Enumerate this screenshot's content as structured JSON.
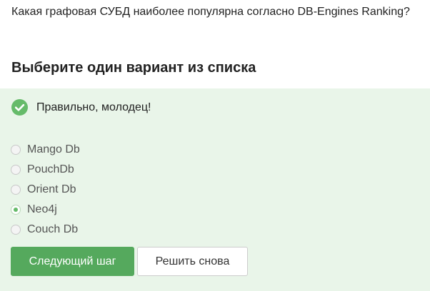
{
  "question": {
    "text": "Какая графовая СУБД наиболее популярна согласно DB-Engines Ranking?"
  },
  "section_title": "Выберите один вариант из списка",
  "feedback": {
    "icon": "check-circle-icon",
    "text": "Правильно, молодец!",
    "color": "#66bb6a"
  },
  "options": [
    {
      "label": "Mango Db",
      "selected": false
    },
    {
      "label": "PouchDb",
      "selected": false
    },
    {
      "label": "Orient Db",
      "selected": false
    },
    {
      "label": "Neo4j",
      "selected": true
    },
    {
      "label": "Couch Db",
      "selected": false
    }
  ],
  "buttons": {
    "next_label": "Следующий шаг",
    "retry_label": "Решить снова"
  },
  "colors": {
    "accent": "#55a95d",
    "panel_background": "#e9f5e9"
  }
}
